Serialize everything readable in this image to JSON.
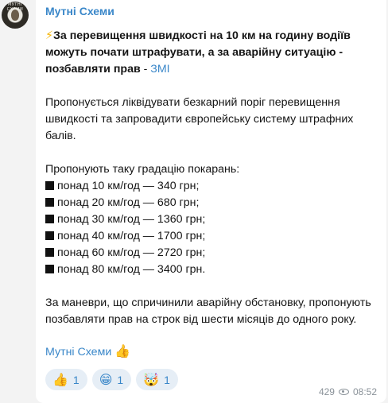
{
  "channel": {
    "name": "Мутні Схеми",
    "avatar_text": "МУТНІ СХЕМИ"
  },
  "message": {
    "bolt": "⚡",
    "headline": "За перевищення швидкості на 10 км на годину водіїв можуть почати штрафувати, а за аварійну ситуацію - позбавляти прав",
    "separator": " - ",
    "source_link": "ЗМІ",
    "paragraph1": "Пропонується ліквідувати безкарний поріг перевищення швидкості та запровадити європейську систему штрафних балів.",
    "list_intro": "Пропонують таку градацію покарань:",
    "list": [
      "понад 10 км/год — 340 грн;",
      "понад 20 км/год — 680 грн;",
      "понад 30 км/год — 1360 грн;",
      "понад 40 км/год — 1700 грн;",
      "понад 60 км/год — 2720 грн;",
      "понад 80 км/год — 3400 грн."
    ],
    "paragraph2": "За маневри, що спричинили аварійну обстановку, пропонують позбавляти прав на строк від шести місяців до одного року.",
    "signature": "Мутні Схеми",
    "signature_emoji": "👍"
  },
  "reactions": [
    {
      "emoji": "👍",
      "count": "1"
    },
    {
      "emoji": "😁",
      "count": "1"
    },
    {
      "emoji": "🤯",
      "count": "1"
    }
  ],
  "meta": {
    "views": "429",
    "time": "08:52"
  },
  "colors": {
    "accent": "#3a87c9",
    "background": "#f3f3f3",
    "bubble": "#ffffff"
  }
}
